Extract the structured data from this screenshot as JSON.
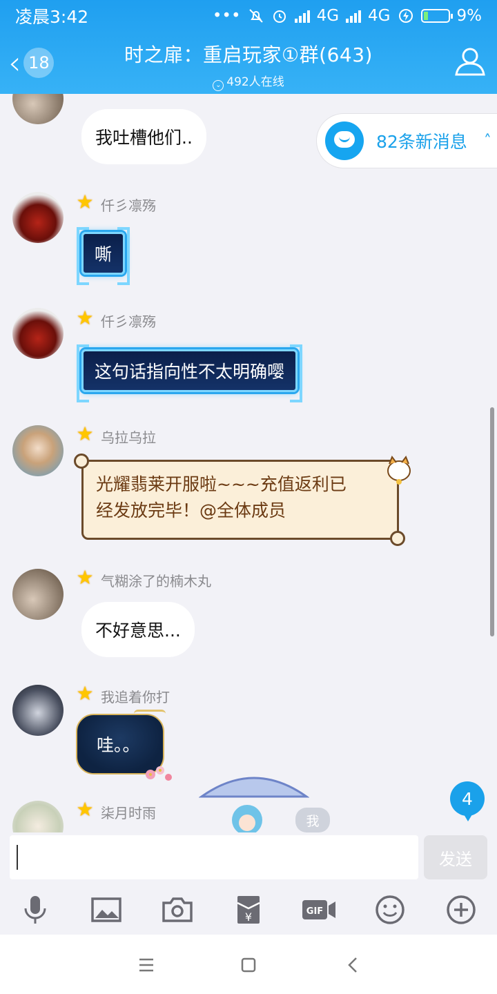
{
  "status_bar": {
    "time": "凌晨3:42",
    "dots": "•••",
    "network1": "4G",
    "network2": "4G",
    "battery": "9%"
  },
  "header": {
    "back_badge": "18",
    "title": "时之扉：重启玩家①群(643)",
    "online": "492人在线",
    "accent": "#1f9ff0"
  },
  "new_messages": {
    "label": "82条新消息"
  },
  "messages": [
    {
      "text": "我吐槽他们.."
    },
    {
      "nick": "仟彡凛殇",
      "text": "嘶"
    },
    {
      "nick": "仟彡凛殇",
      "text": "这句话指向性不太明确嘤"
    },
    {
      "nick": "乌拉乌拉",
      "line1": "光耀翡莱开服啦~~~充值返利已",
      "line2": "经发放完毕！@全体成员"
    },
    {
      "nick": "气糊涂了的楠木丸",
      "text": "不好意思..."
    },
    {
      "nick": "我追着你打",
      "text": "哇。。"
    },
    {
      "nick": "柒月时雨",
      "tag": "我"
    }
  ],
  "unread_count": "4",
  "input": {
    "value": "",
    "send_label": "发送"
  },
  "toolbar": [
    "mic-icon",
    "image-icon",
    "camera-icon",
    "red-packet-icon",
    "gif-icon",
    "emoji-icon",
    "plus-icon"
  ]
}
